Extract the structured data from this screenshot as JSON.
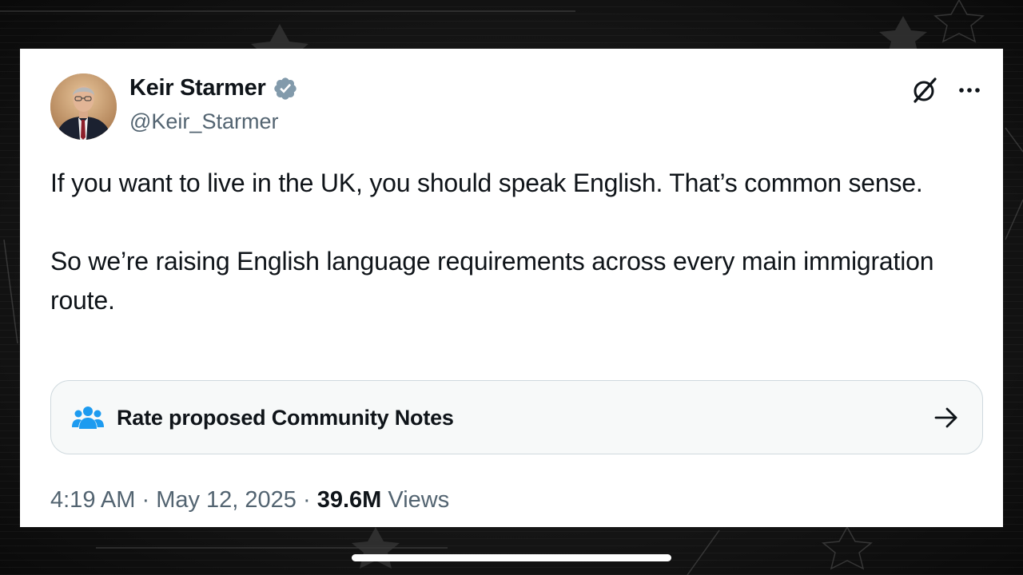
{
  "tweet": {
    "author": {
      "display_name": "Keir Starmer",
      "handle": "@Keir_Starmer",
      "avatar_icon": "profile-photo",
      "verified_icon": "verified-badge-icon",
      "verified_color": "#829aab"
    },
    "actions": {
      "grok_icon": "grok-icon",
      "more_icon": "more-icon"
    },
    "body": {
      "paragraph_1": "If you want to live in the UK, you should speak English. That’s common sense.",
      "paragraph_2": "So we’re raising English language requirements across every main immigration route."
    },
    "community_notes": {
      "icon": "people-icon",
      "icon_color": "#1d9bf0",
      "label": "Rate proposed Community Notes",
      "arrow_icon": "arrow-right-icon"
    },
    "meta": {
      "time": "4:19 AM",
      "separator": " · ",
      "date": "May 12, 2025",
      "views_count": "39.6M",
      "views_label": " Views"
    }
  },
  "theme": {
    "text_primary": "#0f1419",
    "text_secondary": "#536471",
    "card_bg": "#ffffff",
    "backdrop_bg": "#121212"
  }
}
